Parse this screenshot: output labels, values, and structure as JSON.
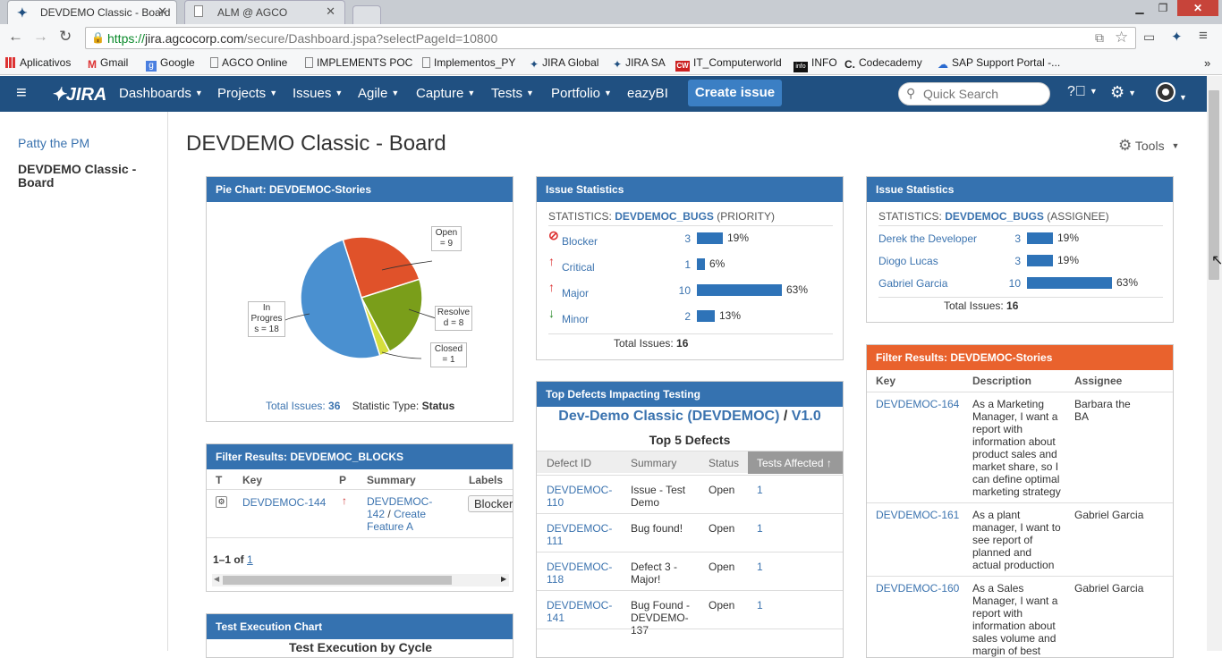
{
  "browser": {
    "tabs": [
      {
        "title": "DEVDEMO Classic - Board",
        "close": "✕"
      },
      {
        "title": "ALM @ AGCO",
        "close": "✕"
      }
    ],
    "url": {
      "scheme": "https://",
      "host": "jira.agcocorp.com",
      "path": "/secure/Dashboard.jspa?selectPageId=10800"
    },
    "bookmarks": [
      "Aplicativos",
      "Gmail",
      "Google",
      "AGCO Online",
      "IMPLEMENTS POC",
      "Implementos_PY",
      "JIRA Global",
      "JIRA SA",
      "IT_Computerworld",
      "INFO",
      "Codecademy",
      "SAP Support Portal -..."
    ],
    "more": "»"
  },
  "jira_nav": {
    "logo": "JIRA",
    "menu": [
      "Dashboards",
      "Projects",
      "Issues",
      "Agile",
      "Capture",
      "Tests",
      "Portfolio",
      "eazyBI"
    ],
    "create": "Create issue",
    "search_placeholder": "Quick Search"
  },
  "sidebar": {
    "items": [
      "Patty the PM",
      "DEVDEMO Classic - Board"
    ]
  },
  "page": {
    "title": "DEVDEMO Classic - Board",
    "tools": "Tools"
  },
  "pie": {
    "title": "Pie Chart: DEVDEMOC-Stories",
    "total_label": "Total Issues:",
    "total": "36",
    "stat_label": "Statistic Type:",
    "stat_value": "Status",
    "labels": {
      "open": [
        "Open",
        "= 9"
      ],
      "resolved": [
        "Resolve",
        "d = 8"
      ],
      "closed": [
        "Closed",
        "= 1"
      ],
      "inprog": [
        "In",
        "Progres",
        "s = 18"
      ]
    }
  },
  "chart_data": {
    "type": "pie",
    "title": "Pie Chart: DEVDEMOC-Stories",
    "slices": [
      {
        "name": "Open",
        "value": 9,
        "color": "#e0522a"
      },
      {
        "name": "Resolved",
        "value": 8,
        "color": "#7a9e1a"
      },
      {
        "name": "Closed",
        "value": 1,
        "color": "#d6de3c"
      },
      {
        "name": "In Progress",
        "value": 18,
        "color": "#4a90d0"
      }
    ]
  },
  "stats1": {
    "title": "Issue Statistics",
    "label": "STATISTICS:",
    "filter": "DEVDEMOC_BUGS",
    "by": "(PRIORITY)",
    "rows": [
      {
        "name": "Blocker",
        "count": "3",
        "pct": "19%",
        "frac": 0.19
      },
      {
        "name": "Critical",
        "count": "1",
        "pct": "6%",
        "frac": 0.06
      },
      {
        "name": "Major",
        "count": "10",
        "pct": "63%",
        "frac": 0.63
      },
      {
        "name": "Minor",
        "count": "2",
        "pct": "13%",
        "frac": 0.13
      }
    ],
    "total_label": "Total Issues:",
    "total": "16"
  },
  "stats2": {
    "title": "Issue Statistics",
    "label": "STATISTICS:",
    "filter": "DEVDEMOC_BUGS",
    "by": "(ASSIGNEE)",
    "rows": [
      {
        "name": "Derek the Developer",
        "count": "3",
        "pct": "19%",
        "frac": 0.19
      },
      {
        "name": "Diogo Lucas",
        "count": "3",
        "pct": "19%",
        "frac": 0.19
      },
      {
        "name": "Gabriel Garcia",
        "count": "10",
        "pct": "63%",
        "frac": 0.63
      }
    ],
    "total_label": "Total Issues:",
    "total": "16"
  },
  "blocks": {
    "title": "Filter Results: DEVDEMOC_BLOCKS",
    "cols": [
      "T",
      "Key",
      "P",
      "Summary",
      "Labels"
    ],
    "row": {
      "key": "DEVDEMOC-144",
      "summary_1": "DEVDEMOC-",
      "summary_2": "142",
      "summary_sep": "/",
      "summary_3": "Create",
      "summary_4": "Feature A",
      "label": "Blocker"
    },
    "pager_prefix": "1–1 of",
    "pager_link": "1"
  },
  "exec": {
    "title": "Test Execution Chart",
    "subtitle": "Test Execution by Cycle"
  },
  "defects": {
    "title": "Top Defects Impacting Testing",
    "project": "Dev-Demo Classic (DEVDEMOC)",
    "sep": "/",
    "version": "V1.0",
    "subtitle": "Top 5 Defects",
    "cols": [
      "Defect ID",
      "Summary",
      "Status",
      "Tests Affected"
    ],
    "rows": [
      {
        "id1": "DEVDEMOC-",
        "id2": "110",
        "s1": "Issue - Test",
        "s2": "Demo",
        "s3": "",
        "status": "Open",
        "n": "1"
      },
      {
        "id1": "DEVDEMOC-",
        "id2": "111",
        "s1": "Bug found!",
        "s2": "",
        "s3": "",
        "status": "Open",
        "n": "1"
      },
      {
        "id1": "DEVDEMOC-",
        "id2": "118",
        "s1": "Defect 3 -",
        "s2": "Major!",
        "s3": "",
        "status": "Open",
        "n": "1"
      },
      {
        "id1": "DEVDEMOC-",
        "id2": "141",
        "s1": "Bug Found -",
        "s2": "DEVDEMO-",
        "s3": "137",
        "status": "Open",
        "n": "1"
      }
    ]
  },
  "stories": {
    "title": "Filter Results: DEVDEMOC-Stories",
    "cols": [
      "Key",
      "Description",
      "Assignee"
    ],
    "rows": [
      {
        "key": "DEVDEMOC-164",
        "desc": [
          "As a Marketing",
          "Manager, I want a",
          "report with",
          "information about",
          "product sales and",
          "market share, so I",
          "can define optimal",
          "marketing strategy"
        ],
        "assignee": [
          "Barbara the",
          "BA"
        ]
      },
      {
        "key": "DEVDEMOC-161",
        "desc": [
          "As a plant",
          "manager, I want to",
          "see report of",
          "planned and",
          "actual production"
        ],
        "assignee": [
          "Gabriel Garcia"
        ]
      },
      {
        "key": "DEVDEMOC-160",
        "desc": [
          "As a Sales",
          "Manager, I want a",
          "report with",
          "information about",
          "sales volume and",
          "margin of best"
        ],
        "assignee": [
          "Gabriel Garcia"
        ]
      }
    ]
  },
  "colors": {
    "nav": "#205081",
    "header": "#3572b0",
    "orange": "#e9622d",
    "link": "#3b73af"
  }
}
